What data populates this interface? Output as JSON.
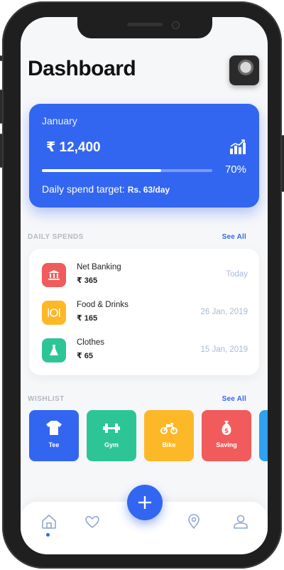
{
  "header": {
    "title": "Dashboard"
  },
  "summary": {
    "month": "January",
    "amount": "₹ 12,400",
    "progress_fraction": 0.7,
    "progress_label": "70%",
    "target_label": "Daily spend target:",
    "target_value": "Rs. 63/day"
  },
  "daily_spends": {
    "heading": "DAILY SPENDS",
    "see_all": "See All",
    "items": [
      {
        "name": "Net Banking",
        "amount": "₹ 365",
        "date": "Today",
        "color": "#f15b5b",
        "icon": "bank-icon"
      },
      {
        "name": "Food & Drinks",
        "amount": "₹ 165",
        "date": "26 Jan, 2019",
        "color": "#fdb827",
        "icon": "food-icon"
      },
      {
        "name": "Clothes",
        "amount": "₹ 65",
        "date": "15 Jan, 2019",
        "color": "#2ec596",
        "icon": "dress-icon"
      }
    ]
  },
  "wishlist": {
    "heading": "WISHLIST",
    "see_all": "See All",
    "items": [
      {
        "label": "Tee",
        "color": "#3366f0",
        "icon": "tshirt-icon"
      },
      {
        "label": "Gym",
        "color": "#2ec596",
        "icon": "dumbbell-icon"
      },
      {
        "label": "Bike",
        "color": "#fdb827",
        "icon": "motorbike-icon"
      },
      {
        "label": "Saving",
        "color": "#f15b5b",
        "icon": "money-bag-icon"
      },
      {
        "label": "",
        "color": "#30a0f0",
        "icon": "partial-card"
      }
    ]
  },
  "bottom_nav": {
    "items": [
      "home-icon",
      "heart-icon",
      "location-icon",
      "profile-icon"
    ],
    "fab": "plus-icon"
  }
}
